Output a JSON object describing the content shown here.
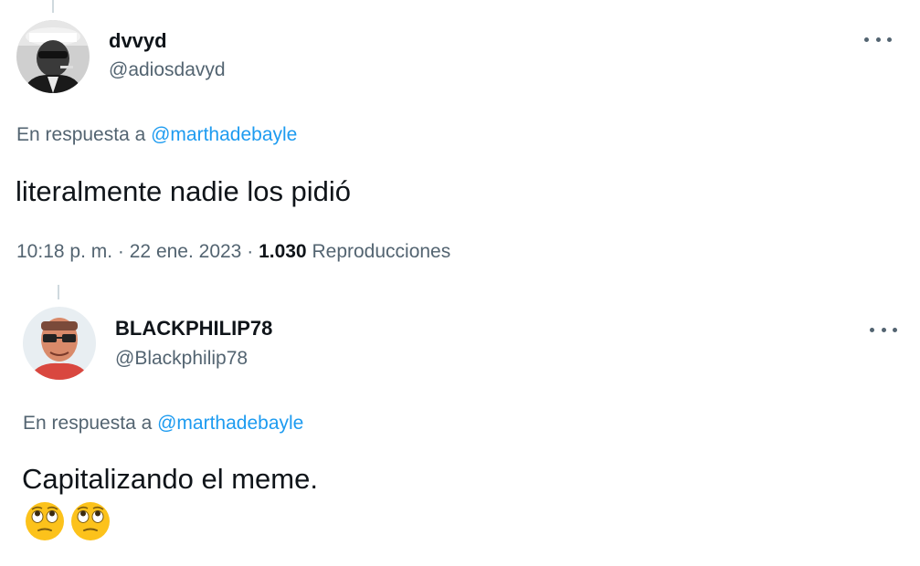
{
  "tweets": [
    {
      "display_name": "dvvyd",
      "handle": "@adiosdavyd",
      "reply_prefix": "En respuesta a",
      "reply_mention": "@marthadebayle",
      "text": "literalmente nadie los pidió",
      "time": "10:18 p. m.",
      "separator": "·",
      "date": "22 ene. 2023",
      "views_count": "1.030",
      "views_label": "Reproducciones"
    },
    {
      "display_name": "BLACKPHILIP78",
      "handle": "@Blackphilip78",
      "reply_prefix": "En respuesta a",
      "reply_mention": "@marthadebayle",
      "text": "Capitalizando el meme.",
      "emojis": [
        "face-with-rolling-eyes",
        "face-with-rolling-eyes"
      ]
    }
  ],
  "colors": {
    "link": "#1d9bf0",
    "secondary_text": "#536471",
    "primary_text": "#0f1419",
    "thread_line": "#cfd9de"
  }
}
